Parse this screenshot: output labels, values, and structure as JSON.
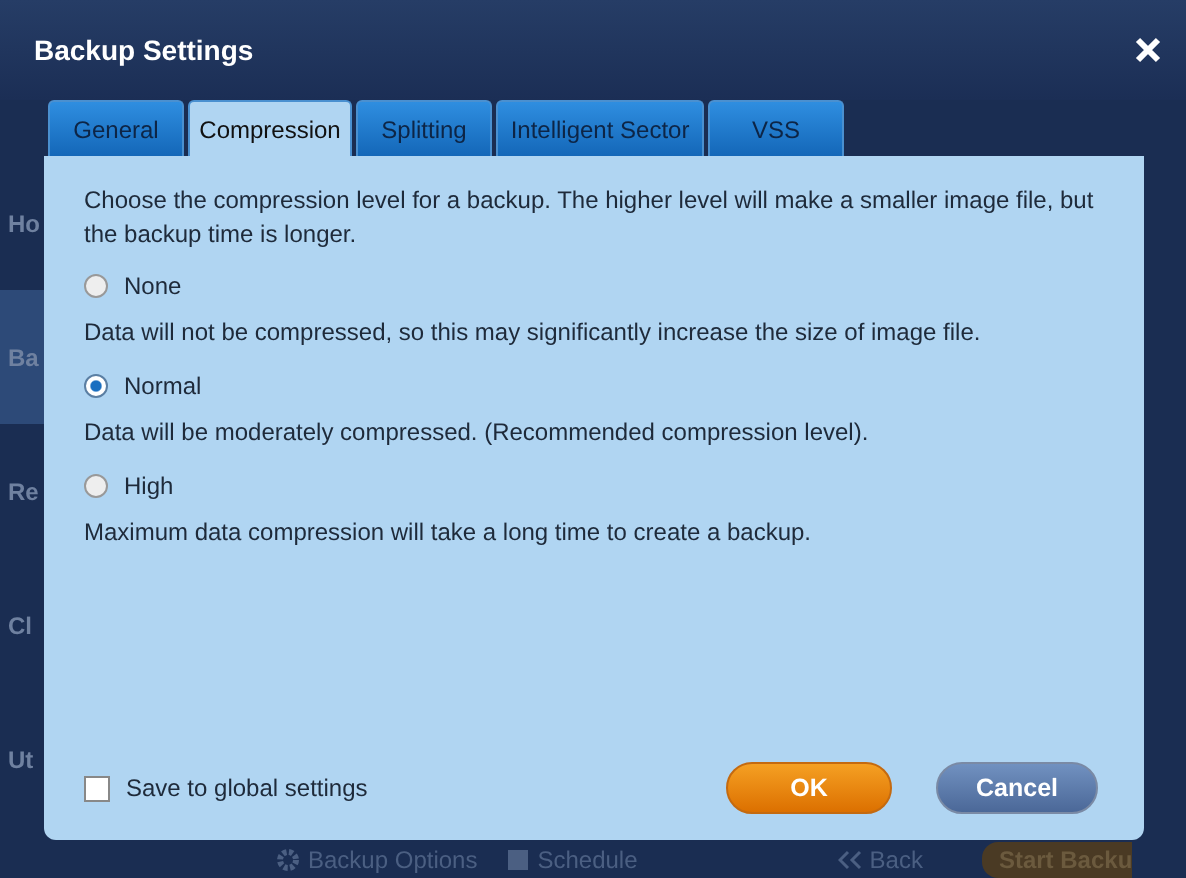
{
  "window": {
    "title": "Backup Settings"
  },
  "background_app": {
    "sidebar": [
      {
        "label": "Ho",
        "selected": false
      },
      {
        "label": "Ba",
        "selected": true
      },
      {
        "label": "Re",
        "selected": false
      },
      {
        "label": "Cl",
        "selected": false
      },
      {
        "label": "Ut",
        "selected": false
      }
    ],
    "bottom_bar": [
      {
        "label": "Backup Options",
        "kind": "gear"
      },
      {
        "label": "Schedule",
        "kind": "calendar"
      },
      {
        "label": "Back",
        "kind": "back"
      },
      {
        "label": "Start Backu",
        "kind": "primary"
      }
    ]
  },
  "tabs": [
    {
      "label": "General",
      "selected": false
    },
    {
      "label": "Compression",
      "selected": true
    },
    {
      "label": "Splitting",
      "selected": false
    },
    {
      "label": "Intelligent Sector",
      "selected": false
    },
    {
      "label": "VSS",
      "selected": false
    }
  ],
  "intro": "Choose the compression level for a backup. The higher level will make a smaller image file, but the backup time is longer.",
  "options": [
    {
      "label": "None",
      "description": "Data will not be compressed, so this may significantly increase the size of image file.",
      "selected": false
    },
    {
      "label": "Normal",
      "description": "Data will be moderately compressed. (Recommended compression level).",
      "selected": true
    },
    {
      "label": "High",
      "description": "Maximum data compression will take a long time to create a backup.",
      "selected": false
    }
  ],
  "save_global": {
    "label": "Save to global settings",
    "checked": false
  },
  "buttons": [
    {
      "label": "OK",
      "kind": "primary"
    },
    {
      "label": "Cancel",
      "kind": "secondary"
    }
  ]
}
